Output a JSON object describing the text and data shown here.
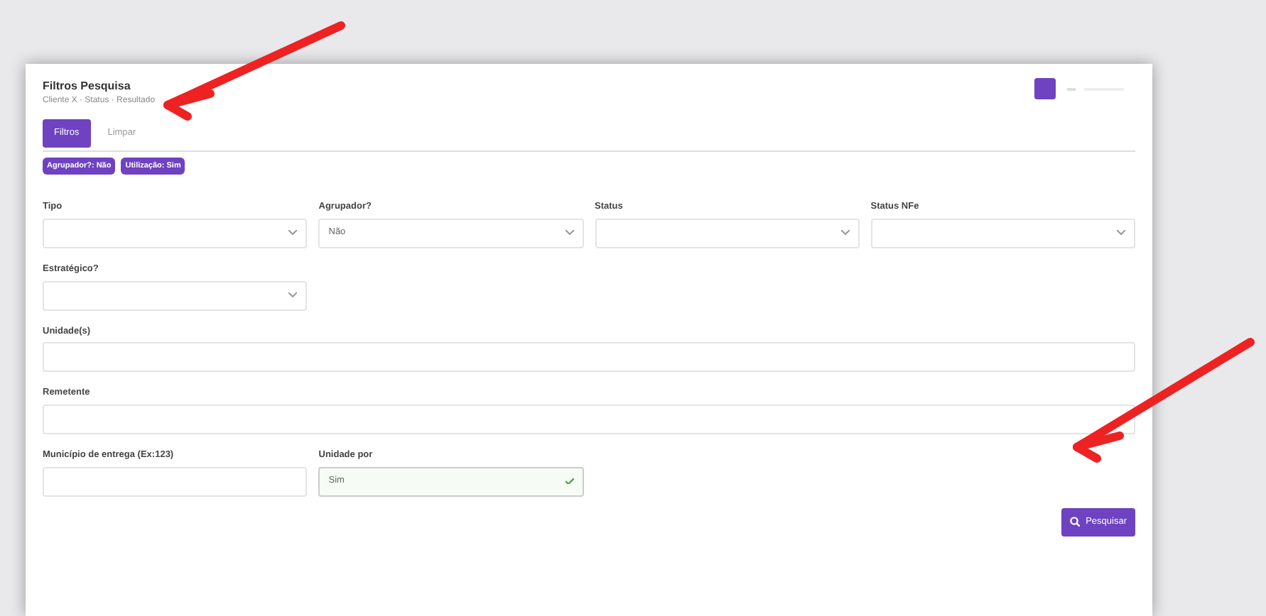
{
  "header": {
    "title": "Filtros Pesquisa",
    "subtitle": "Cliente X · Status · Resultado"
  },
  "toolbar": {
    "tabs": [
      {
        "label": "Filtros",
        "selected": true
      },
      {
        "label": "Limpar",
        "selected": false
      }
    ],
    "badges": [
      "Agrupador?: Não",
      "Utilização: Sim"
    ]
  },
  "filters": [
    {
      "kind": "select",
      "label": "Tipo"
    },
    {
      "kind": "select",
      "label": "Agrupador?",
      "value": "Não"
    },
    {
      "kind": "select",
      "label": "Status"
    },
    {
      "kind": "select",
      "label": "Status NFe"
    },
    {
      "kind": "select",
      "label": "Estratégico?"
    },
    {
      "kind": "wide-input",
      "label": "Unidade(s)"
    },
    {
      "kind": "wide-input",
      "label": "Remetente"
    },
    {
      "kind": "input",
      "label": "Município de entrega (Ex:123)"
    },
    {
      "kind": "select",
      "label": "Unidade por",
      "value": "Sim",
      "valid": true
    }
  ],
  "search_button": "Pesquisar",
  "annotations": [
    {
      "kind": "arrow"
    },
    {
      "kind": "arrow"
    }
  ]
}
